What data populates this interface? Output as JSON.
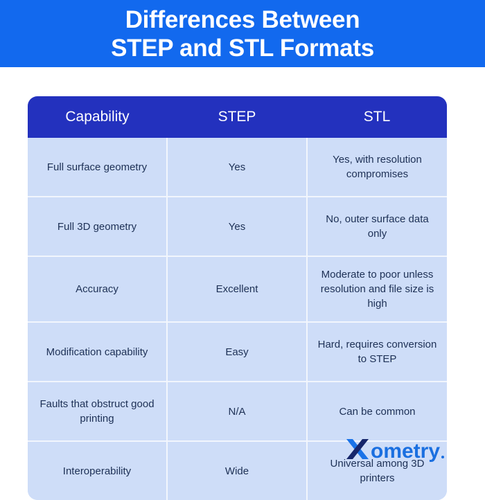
{
  "banner": {
    "title_line_1": "Differences Between",
    "title_line_2": "STEP and STL Formats",
    "background_color": "#1269EE",
    "text_color": "#FFFFFF"
  },
  "table": {
    "header_background": "#2331BE",
    "row_background": "#CEDDF8",
    "row_text_color": "#1D3055",
    "divider_color": "#F2F6FD",
    "columns": [
      "Capability",
      "STEP",
      "STL"
    ],
    "rows": [
      {
        "capability": "Full surface geometry",
        "step": "Yes",
        "stl": "Yes, with resolution compromises"
      },
      {
        "capability": "Full 3D geometry",
        "step": "Yes",
        "stl": "No, outer surface data only"
      },
      {
        "capability": "Accuracy",
        "step": "Excellent",
        "stl": "Moderate to poor unless resolution and file size is high"
      },
      {
        "capability": "Modification capability",
        "step": "Easy",
        "stl": "Hard, requires conversion to STEP"
      },
      {
        "capability": "Faults that obstruct good printing",
        "step": "N/A",
        "stl": "Can be common"
      },
      {
        "capability": "Interoperability",
        "step": "Wide",
        "stl": "Universal among 3D printers"
      }
    ]
  },
  "logo": {
    "name": "Xometry",
    "wordmark": "ometry",
    "mark_color_light": "#1A73E8",
    "mark_color_dark": "#16266B",
    "wordmark_color": "#1A6FE0"
  }
}
